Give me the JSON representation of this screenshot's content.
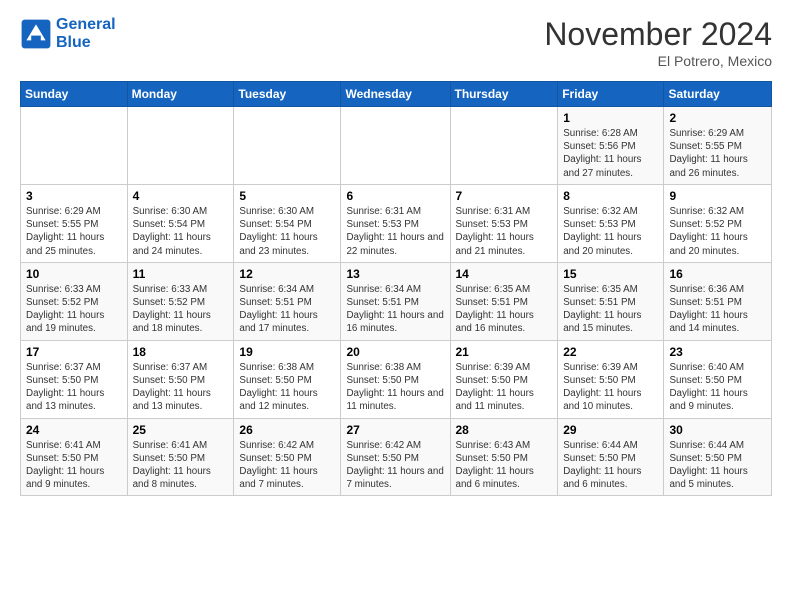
{
  "header": {
    "logo_line1": "General",
    "logo_line2": "Blue",
    "month_title": "November 2024",
    "location": "El Potrero, Mexico"
  },
  "days_of_week": [
    "Sunday",
    "Monday",
    "Tuesday",
    "Wednesday",
    "Thursday",
    "Friday",
    "Saturday"
  ],
  "weeks": [
    [
      {
        "day": "",
        "info": ""
      },
      {
        "day": "",
        "info": ""
      },
      {
        "day": "",
        "info": ""
      },
      {
        "day": "",
        "info": ""
      },
      {
        "day": "",
        "info": ""
      },
      {
        "day": "1",
        "info": "Sunrise: 6:28 AM\nSunset: 5:56 PM\nDaylight: 11 hours and 27 minutes."
      },
      {
        "day": "2",
        "info": "Sunrise: 6:29 AM\nSunset: 5:55 PM\nDaylight: 11 hours and 26 minutes."
      }
    ],
    [
      {
        "day": "3",
        "info": "Sunrise: 6:29 AM\nSunset: 5:55 PM\nDaylight: 11 hours and 25 minutes."
      },
      {
        "day": "4",
        "info": "Sunrise: 6:30 AM\nSunset: 5:54 PM\nDaylight: 11 hours and 24 minutes."
      },
      {
        "day": "5",
        "info": "Sunrise: 6:30 AM\nSunset: 5:54 PM\nDaylight: 11 hours and 23 minutes."
      },
      {
        "day": "6",
        "info": "Sunrise: 6:31 AM\nSunset: 5:53 PM\nDaylight: 11 hours and 22 minutes."
      },
      {
        "day": "7",
        "info": "Sunrise: 6:31 AM\nSunset: 5:53 PM\nDaylight: 11 hours and 21 minutes."
      },
      {
        "day": "8",
        "info": "Sunrise: 6:32 AM\nSunset: 5:53 PM\nDaylight: 11 hours and 20 minutes."
      },
      {
        "day": "9",
        "info": "Sunrise: 6:32 AM\nSunset: 5:52 PM\nDaylight: 11 hours and 20 minutes."
      }
    ],
    [
      {
        "day": "10",
        "info": "Sunrise: 6:33 AM\nSunset: 5:52 PM\nDaylight: 11 hours and 19 minutes."
      },
      {
        "day": "11",
        "info": "Sunrise: 6:33 AM\nSunset: 5:52 PM\nDaylight: 11 hours and 18 minutes."
      },
      {
        "day": "12",
        "info": "Sunrise: 6:34 AM\nSunset: 5:51 PM\nDaylight: 11 hours and 17 minutes."
      },
      {
        "day": "13",
        "info": "Sunrise: 6:34 AM\nSunset: 5:51 PM\nDaylight: 11 hours and 16 minutes."
      },
      {
        "day": "14",
        "info": "Sunrise: 6:35 AM\nSunset: 5:51 PM\nDaylight: 11 hours and 16 minutes."
      },
      {
        "day": "15",
        "info": "Sunrise: 6:35 AM\nSunset: 5:51 PM\nDaylight: 11 hours and 15 minutes."
      },
      {
        "day": "16",
        "info": "Sunrise: 6:36 AM\nSunset: 5:51 PM\nDaylight: 11 hours and 14 minutes."
      }
    ],
    [
      {
        "day": "17",
        "info": "Sunrise: 6:37 AM\nSunset: 5:50 PM\nDaylight: 11 hours and 13 minutes."
      },
      {
        "day": "18",
        "info": "Sunrise: 6:37 AM\nSunset: 5:50 PM\nDaylight: 11 hours and 13 minutes."
      },
      {
        "day": "19",
        "info": "Sunrise: 6:38 AM\nSunset: 5:50 PM\nDaylight: 11 hours and 12 minutes."
      },
      {
        "day": "20",
        "info": "Sunrise: 6:38 AM\nSunset: 5:50 PM\nDaylight: 11 hours and 11 minutes."
      },
      {
        "day": "21",
        "info": "Sunrise: 6:39 AM\nSunset: 5:50 PM\nDaylight: 11 hours and 11 minutes."
      },
      {
        "day": "22",
        "info": "Sunrise: 6:39 AM\nSunset: 5:50 PM\nDaylight: 11 hours and 10 minutes."
      },
      {
        "day": "23",
        "info": "Sunrise: 6:40 AM\nSunset: 5:50 PM\nDaylight: 11 hours and 9 minutes."
      }
    ],
    [
      {
        "day": "24",
        "info": "Sunrise: 6:41 AM\nSunset: 5:50 PM\nDaylight: 11 hours and 9 minutes."
      },
      {
        "day": "25",
        "info": "Sunrise: 6:41 AM\nSunset: 5:50 PM\nDaylight: 11 hours and 8 minutes."
      },
      {
        "day": "26",
        "info": "Sunrise: 6:42 AM\nSunset: 5:50 PM\nDaylight: 11 hours and 7 minutes."
      },
      {
        "day": "27",
        "info": "Sunrise: 6:42 AM\nSunset: 5:50 PM\nDaylight: 11 hours and 7 minutes."
      },
      {
        "day": "28",
        "info": "Sunrise: 6:43 AM\nSunset: 5:50 PM\nDaylight: 11 hours and 6 minutes."
      },
      {
        "day": "29",
        "info": "Sunrise: 6:44 AM\nSunset: 5:50 PM\nDaylight: 11 hours and 6 minutes."
      },
      {
        "day": "30",
        "info": "Sunrise: 6:44 AM\nSunset: 5:50 PM\nDaylight: 11 hours and 5 minutes."
      }
    ]
  ]
}
